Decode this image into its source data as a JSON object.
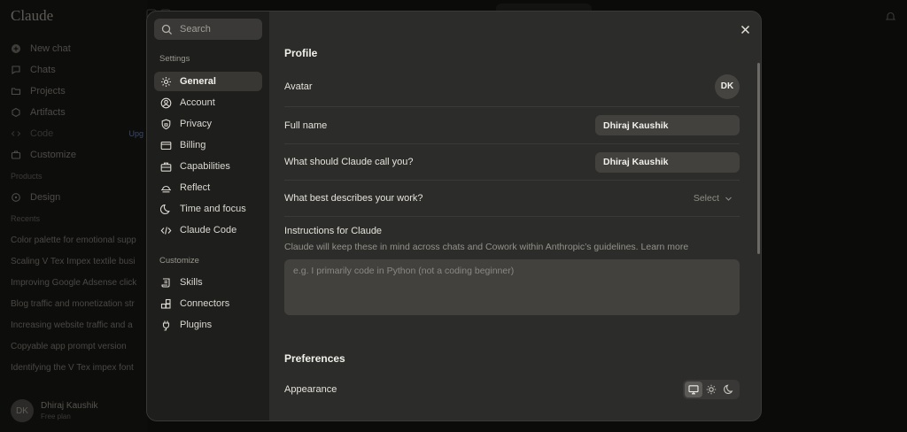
{
  "background": {
    "logo": "Claude",
    "nav": [
      {
        "label": "New chat",
        "icon": "plus-icon"
      },
      {
        "label": "Chats",
        "icon": "chat-icon"
      },
      {
        "label": "Projects",
        "icon": "folder-icon"
      },
      {
        "label": "Artifacts",
        "icon": "artifacts-icon"
      },
      {
        "label": "Code",
        "icon": "code-icon",
        "tag": "Upg"
      },
      {
        "label": "Customize",
        "icon": "briefcase-icon"
      }
    ],
    "products_heading": "Products",
    "products": [
      {
        "label": "Design",
        "icon": "design-icon"
      }
    ],
    "recents_heading": "Recents",
    "recents": [
      "Color palette for emotional supp",
      "Scaling V Tex Impex textile busi",
      "Improving Google Adsense click",
      "Blog traffic and monetization str",
      "Increasing website traffic and a",
      "Copyable app prompt version",
      "Identifying the V Tex impex font"
    ],
    "user": {
      "initials": "DK",
      "name": "Dhiraj Kaushik",
      "plan": "Free plan"
    }
  },
  "settings": {
    "search_placeholder": "Search",
    "settings_heading": "Settings",
    "items": [
      {
        "label": "General",
        "icon": "gear-icon",
        "active": true
      },
      {
        "label": "Account",
        "icon": "user-circle-icon"
      },
      {
        "label": "Privacy",
        "icon": "shield-lock-icon"
      },
      {
        "label": "Billing",
        "icon": "credit-card-icon"
      },
      {
        "label": "Capabilities",
        "icon": "toolbox-icon"
      },
      {
        "label": "Reflect",
        "icon": "sunrise-icon"
      },
      {
        "label": "Time and focus",
        "icon": "moon-icon"
      },
      {
        "label": "Claude Code",
        "icon": "code-brackets-icon"
      }
    ],
    "customize_heading": "Customize",
    "customize_items": [
      {
        "label": "Skills",
        "icon": "scroll-icon"
      },
      {
        "label": "Connectors",
        "icon": "connectors-icon"
      },
      {
        "label": "Plugins",
        "icon": "plug-icon"
      }
    ]
  },
  "profile": {
    "title": "Profile",
    "avatar_label": "Avatar",
    "avatar_initials": "DK",
    "full_name_label": "Full name",
    "full_name_value": "Dhiraj Kaushik",
    "call_you_label": "What should Claude call you?",
    "call_you_value": "Dhiraj Kaushik",
    "work_label": "What best describes your work?",
    "work_select": "Select",
    "instructions_title": "Instructions for Claude",
    "instructions_desc": "Claude will keep these in mind across chats and Cowork within Anthropic’s guidelines. Learn more",
    "instructions_placeholder": "e.g. I primarily code in Python (not a coding beginner)"
  },
  "preferences": {
    "title": "Preferences",
    "appearance_label": "Appearance",
    "appearance_options": [
      {
        "icon": "monitor-icon",
        "active": true
      },
      {
        "icon": "sun-icon"
      },
      {
        "icon": "moon-icon"
      }
    ]
  },
  "colors": {
    "modal_bg": "#2c2c2a",
    "sidebar_bg": "#1e1e1d",
    "input_bg": "#42413e",
    "active_item_bg": "#383734"
  }
}
